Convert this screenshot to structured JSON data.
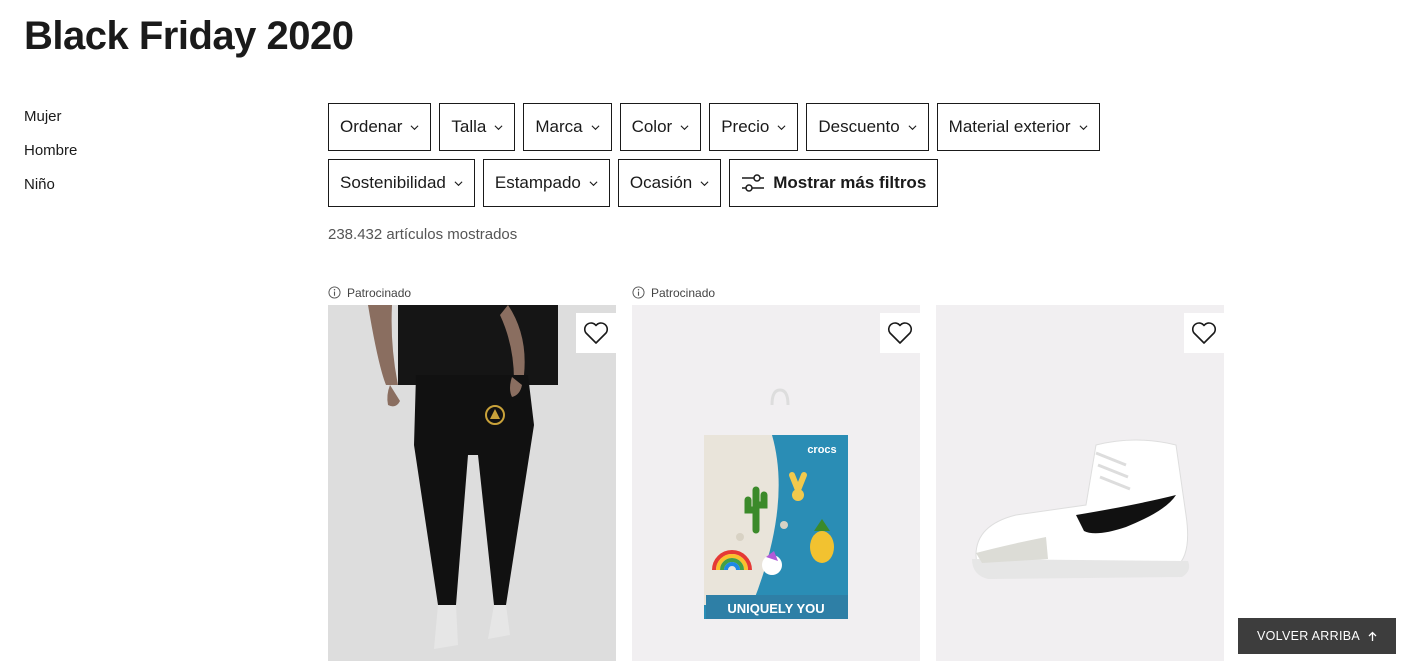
{
  "page": {
    "title": "Black Friday 2020"
  },
  "side_nav": [
    {
      "label": "Mujer"
    },
    {
      "label": "Hombre"
    },
    {
      "label": "Niño"
    }
  ],
  "filters": {
    "row1": [
      {
        "label": "Ordenar"
      },
      {
        "label": "Talla"
      },
      {
        "label": "Marca"
      },
      {
        "label": "Color"
      },
      {
        "label": "Precio"
      },
      {
        "label": "Descuento"
      },
      {
        "label": "Material exterior"
      }
    ],
    "row2": [
      {
        "label": "Sostenibilidad"
      },
      {
        "label": "Estampado"
      },
      {
        "label": "Ocasión"
      }
    ],
    "more_label": "Mostrar más filtros"
  },
  "results": {
    "count_text": "238.432 artículos mostrados"
  },
  "products": [
    {
      "sponsored_label": "Patrocinado",
      "image": "black-jogger-pants-model",
      "background": "#dcdcdc"
    },
    {
      "sponsored_label": "Patrocinado",
      "image": "crocs-jibbitz-pack",
      "background": "#f1eff1",
      "image_text": {
        "brand": "crocs",
        "tagline": "UNIQUELY YOU"
      }
    },
    {
      "sponsored_label": "",
      "image": "white-high-top-sneaker",
      "background": "#f1eff1"
    }
  ],
  "back_to_top": {
    "label": "VOLVER ARRIBA"
  },
  "colors": {
    "text": "#1a1a1a",
    "muted": "#555555",
    "back_top_bg": "#3d3d3d"
  }
}
